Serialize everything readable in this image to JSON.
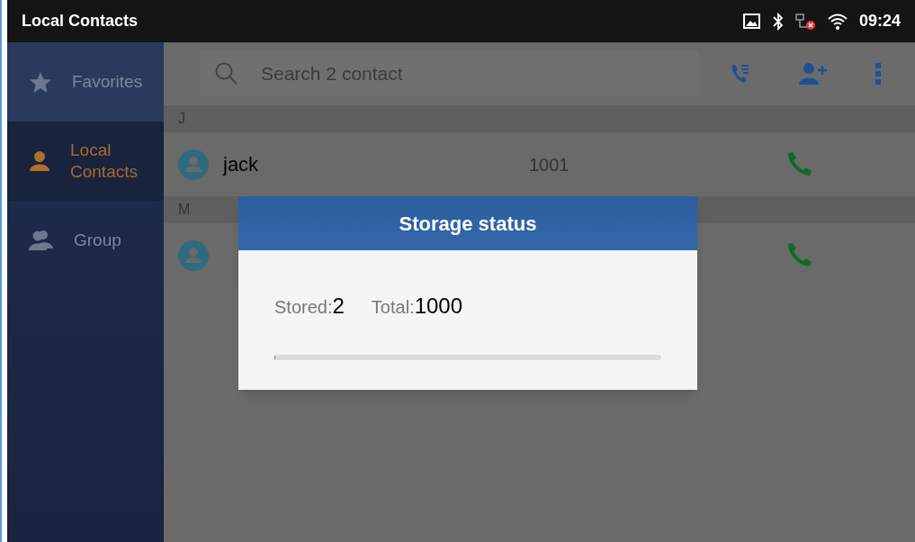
{
  "status_bar": {
    "title": "Local Contacts",
    "time": "09:24"
  },
  "sidebar": {
    "items": [
      {
        "kind": "star",
        "label": "Favorites",
        "selected": false
      },
      {
        "kind": "person",
        "label": "Local Contacts",
        "selected": true
      },
      {
        "kind": "group",
        "label": "Group",
        "selected": false
      }
    ]
  },
  "search": {
    "placeholder": "Search 2 contact"
  },
  "contacts": [
    {
      "letter": "J",
      "name": "jack",
      "number": "1001"
    },
    {
      "letter": "M"
    }
  ],
  "dialog": {
    "title": "Storage status",
    "stored_label": "Stored:",
    "stored": "2",
    "total_label": "Total:",
    "total": "1000",
    "level": 0.002
  }
}
